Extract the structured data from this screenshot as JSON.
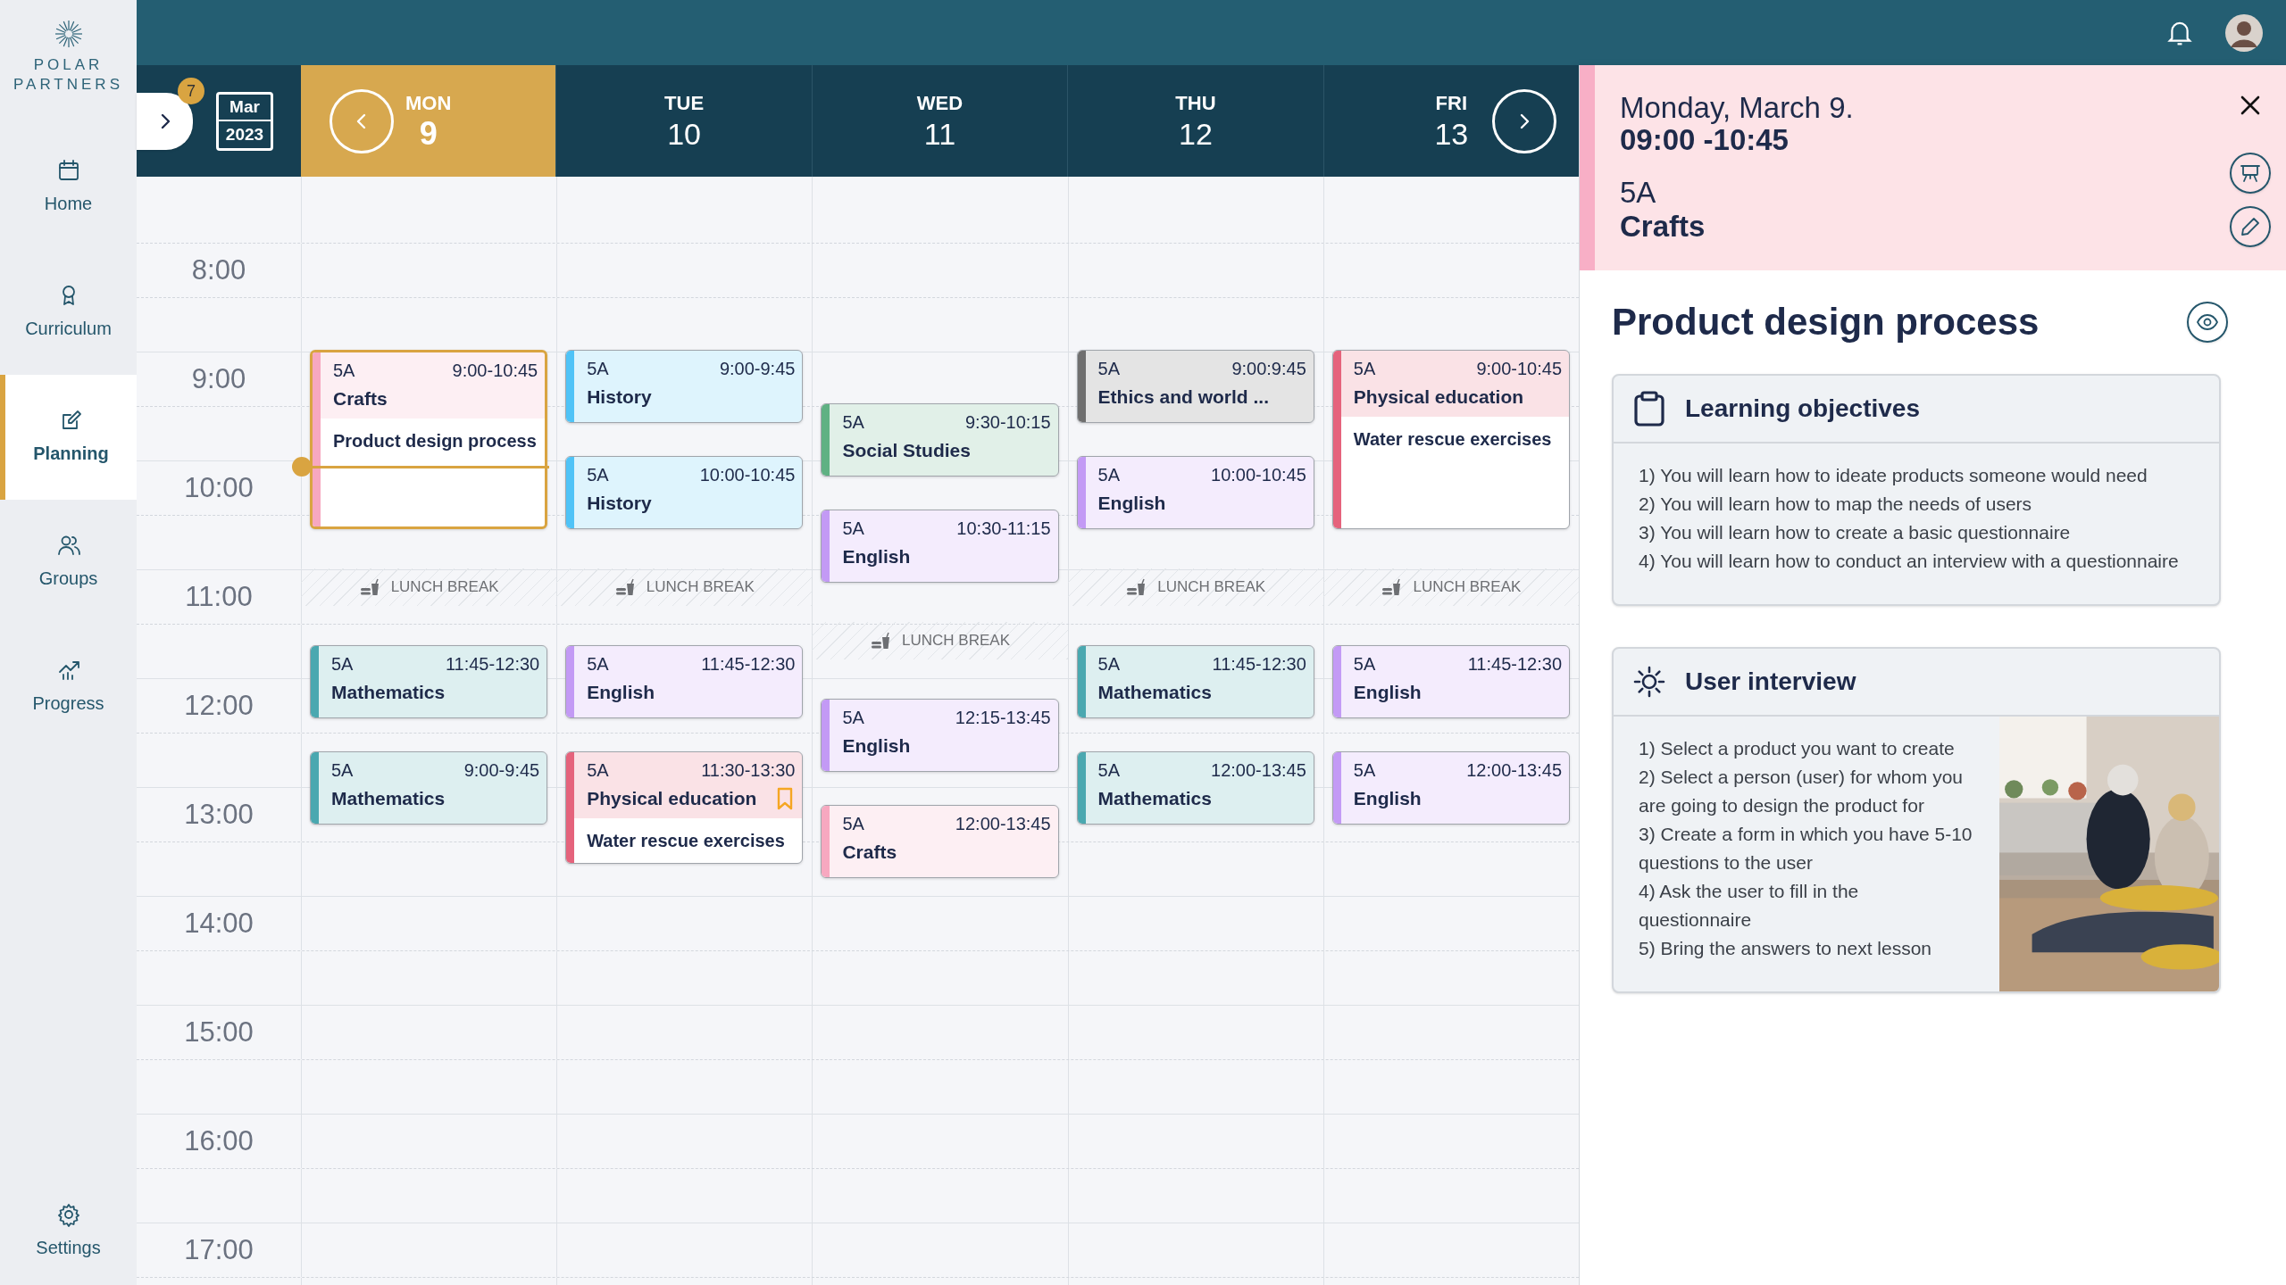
{
  "sidebar": {
    "logo": {
      "line_1": "POLAR",
      "line_2": "PARTNERS"
    },
    "items": [
      {
        "label": "Home",
        "selected": false
      },
      {
        "label": "Curriculum",
        "selected": false
      },
      {
        "label": "Planning",
        "selected": true
      },
      {
        "label": "Groups",
        "selected": false
      },
      {
        "label": "Progress",
        "selected": false
      }
    ],
    "footer_item": {
      "label": "Settings"
    }
  },
  "week_header": {
    "toggle_badge": "7",
    "calendar_month": "Mar",
    "calendar_year": "2023",
    "days": [
      {
        "name": "MON",
        "date": "9",
        "selected": true
      },
      {
        "name": "TUE",
        "date": "10",
        "selected": false
      },
      {
        "name": "WED",
        "date": "11",
        "selected": false
      },
      {
        "name": "THU",
        "date": "12",
        "selected": false
      },
      {
        "name": "FRI",
        "date": "13",
        "selected": false
      }
    ]
  },
  "time_labels": [
    "8:00",
    "9:00",
    "10:00",
    "11:00",
    "12:00",
    "13:00",
    "14:00",
    "15:00",
    "16:00",
    "17:00"
  ],
  "columns": [
    {
      "items": [
        {
          "kind": "long_event",
          "group": "5A",
          "time": "9:00-10:45",
          "subject": "Crafts",
          "note": "Product design process",
          "color": "#f7a8c0",
          "selected": true,
          "bookmarked": false
        },
        {
          "kind": "lunch",
          "label": "LUNCH BREAK"
        },
        {
          "kind": "event",
          "group": "5A",
          "time": "11:45-12:30",
          "subject": "Mathematics",
          "color": "#4aa8b0",
          "selected": false,
          "bookmarked": false
        },
        {
          "kind": "event",
          "group": "5A",
          "time": "9:00-9:45",
          "subject": "Mathematics",
          "color": "#4aa8b0",
          "selected": false,
          "bookmarked": false
        }
      ]
    },
    {
      "items": [
        {
          "kind": "event",
          "group": "5A",
          "time": "9:00-9:45",
          "subject": "History",
          "color": "#4fc3f7",
          "selected": false,
          "bookmarked": false
        },
        {
          "kind": "event",
          "group": "5A",
          "time": "10:00-10:45",
          "subject": "History",
          "color": "#4fc3f7",
          "selected": false,
          "bookmarked": false
        },
        {
          "kind": "lunch",
          "label": "LUNCH BREAK"
        },
        {
          "kind": "event",
          "group": "5A",
          "time": "11:45-12:30",
          "subject": "English",
          "color": "#c39af5",
          "selected": false,
          "bookmarked": false
        },
        {
          "kind": "event",
          "group": "5A",
          "time": "11:30-13:30",
          "subject": "Physical education",
          "note": "Water rescue exercises",
          "color": "#e5637c",
          "selected": false,
          "bookmarked": true
        }
      ]
    },
    {
      "items": [
        {
          "kind": "event",
          "group": "5A",
          "time": "9:30-10:15",
          "subject": "Social Studies",
          "color": "#5fb183",
          "selected": false,
          "bookmarked": false
        },
        {
          "kind": "event",
          "group": "5A",
          "time": "10:30-11:15",
          "subject": "English",
          "color": "#c39af5",
          "selected": false,
          "bookmarked": false
        },
        {
          "kind": "lunch",
          "label": "LUNCH BREAK"
        },
        {
          "kind": "event",
          "group": "5A",
          "time": "12:15-13:45",
          "subject": "English",
          "color": "#c39af5",
          "selected": false,
          "bookmarked": false
        },
        {
          "kind": "event",
          "group": "5A",
          "time": "12:00-13:45",
          "subject": "Crafts",
          "color": "#f7a8c0",
          "selected": false,
          "bookmarked": false
        }
      ]
    },
    {
      "items": [
        {
          "kind": "event",
          "group": "5A",
          "time": "9:00:9:45",
          "subject": "Ethics and world ...",
          "color": "#6f6f6f",
          "selected": false,
          "bookmarked": false
        },
        {
          "kind": "event",
          "group": "5A",
          "time": "10:00-10:45",
          "subject": "English",
          "color": "#c39af5",
          "selected": false,
          "bookmarked": false
        },
        {
          "kind": "lunch",
          "label": "LUNCH BREAK"
        },
        {
          "kind": "event",
          "group": "5A",
          "time": "11:45-12:30",
          "subject": "Mathematics",
          "color": "#4aa8b0",
          "selected": false,
          "bookmarked": false
        },
        {
          "kind": "event",
          "group": "5A",
          "time": "12:00-13:45",
          "subject": "Mathematics",
          "color": "#4aa8b0",
          "selected": false,
          "bookmarked": false
        }
      ]
    },
    {
      "items": [
        {
          "kind": "long_event",
          "group": "5A",
          "time": "9:00-10:45",
          "subject": "Physical education",
          "note": "Water rescue exercises",
          "color": "#e5637c",
          "selected": false,
          "bookmarked": false
        },
        {
          "kind": "lunch",
          "label": "LUNCH BREAK"
        },
        {
          "kind": "event",
          "group": "5A",
          "time": "11:45-12:30",
          "subject": "English",
          "color": "#c39af5",
          "selected": false,
          "bookmarked": false
        },
        {
          "kind": "event",
          "group": "5A",
          "time": "12:00-13:45",
          "subject": "English",
          "color": "#c39af5",
          "selected": false,
          "bookmarked": false
        }
      ]
    }
  ],
  "detail_panel": {
    "date": "Monday, March 9.",
    "time": "09:00 -10:45",
    "group": "5A",
    "subject": "Crafts",
    "title": "Product design process",
    "sections": [
      {
        "kind": "list",
        "title": "Learning objectives",
        "lines": [
          "1) You will learn how to ideate products someone would need",
          "2) You will learn how to map the needs of users",
          "3) You will learn how to create a basic questionnaire",
          "4) You will learn how to conduct an interview with a questionnaire"
        ]
      },
      {
        "kind": "illustrated",
        "title": "User interview",
        "lines": [
          "1) Select a product you want to create",
          "2) Select a person (user) for whom you are going to design the product for",
          "3) Create a form in which you have 5-10 questions to the user",
          "4) Ask the user to fill in the questionnaire",
          "5) Bring the answers to next lesson"
        ]
      }
    ]
  }
}
